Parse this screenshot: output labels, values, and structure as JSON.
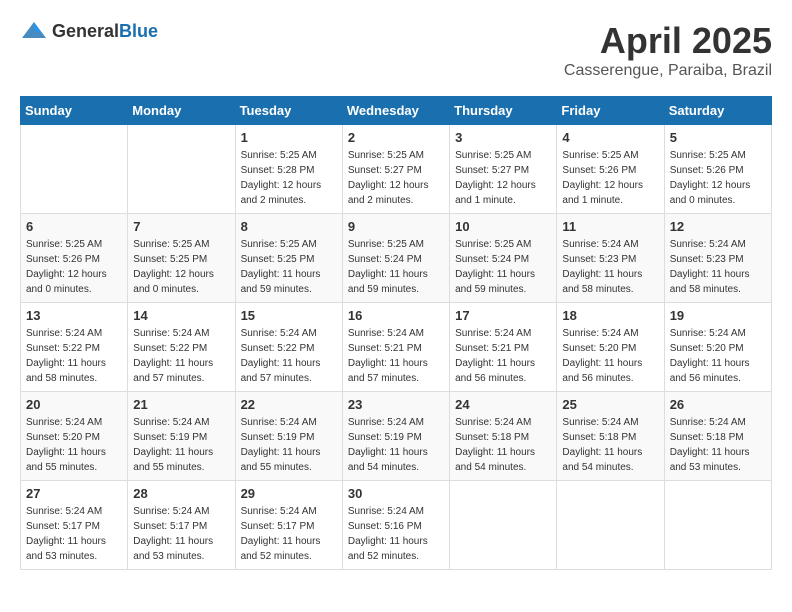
{
  "logo": {
    "general": "General",
    "blue": "Blue"
  },
  "header": {
    "month": "April 2025",
    "location": "Casserengue, Paraiba, Brazil"
  },
  "weekdays": [
    "Sunday",
    "Monday",
    "Tuesday",
    "Wednesday",
    "Thursday",
    "Friday",
    "Saturday"
  ],
  "weeks": [
    [
      {
        "day": "",
        "info": ""
      },
      {
        "day": "",
        "info": ""
      },
      {
        "day": "1",
        "info": "Sunrise: 5:25 AM\nSunset: 5:28 PM\nDaylight: 12 hours\nand 2 minutes."
      },
      {
        "day": "2",
        "info": "Sunrise: 5:25 AM\nSunset: 5:27 PM\nDaylight: 12 hours\nand 2 minutes."
      },
      {
        "day": "3",
        "info": "Sunrise: 5:25 AM\nSunset: 5:27 PM\nDaylight: 12 hours\nand 1 minute."
      },
      {
        "day": "4",
        "info": "Sunrise: 5:25 AM\nSunset: 5:26 PM\nDaylight: 12 hours\nand 1 minute."
      },
      {
        "day": "5",
        "info": "Sunrise: 5:25 AM\nSunset: 5:26 PM\nDaylight: 12 hours\nand 0 minutes."
      }
    ],
    [
      {
        "day": "6",
        "info": "Sunrise: 5:25 AM\nSunset: 5:26 PM\nDaylight: 12 hours\nand 0 minutes."
      },
      {
        "day": "7",
        "info": "Sunrise: 5:25 AM\nSunset: 5:25 PM\nDaylight: 12 hours\nand 0 minutes."
      },
      {
        "day": "8",
        "info": "Sunrise: 5:25 AM\nSunset: 5:25 PM\nDaylight: 11 hours\nand 59 minutes."
      },
      {
        "day": "9",
        "info": "Sunrise: 5:25 AM\nSunset: 5:24 PM\nDaylight: 11 hours\nand 59 minutes."
      },
      {
        "day": "10",
        "info": "Sunrise: 5:25 AM\nSunset: 5:24 PM\nDaylight: 11 hours\nand 59 minutes."
      },
      {
        "day": "11",
        "info": "Sunrise: 5:24 AM\nSunset: 5:23 PM\nDaylight: 11 hours\nand 58 minutes."
      },
      {
        "day": "12",
        "info": "Sunrise: 5:24 AM\nSunset: 5:23 PM\nDaylight: 11 hours\nand 58 minutes."
      }
    ],
    [
      {
        "day": "13",
        "info": "Sunrise: 5:24 AM\nSunset: 5:22 PM\nDaylight: 11 hours\nand 58 minutes."
      },
      {
        "day": "14",
        "info": "Sunrise: 5:24 AM\nSunset: 5:22 PM\nDaylight: 11 hours\nand 57 minutes."
      },
      {
        "day": "15",
        "info": "Sunrise: 5:24 AM\nSunset: 5:22 PM\nDaylight: 11 hours\nand 57 minutes."
      },
      {
        "day": "16",
        "info": "Sunrise: 5:24 AM\nSunset: 5:21 PM\nDaylight: 11 hours\nand 57 minutes."
      },
      {
        "day": "17",
        "info": "Sunrise: 5:24 AM\nSunset: 5:21 PM\nDaylight: 11 hours\nand 56 minutes."
      },
      {
        "day": "18",
        "info": "Sunrise: 5:24 AM\nSunset: 5:20 PM\nDaylight: 11 hours\nand 56 minutes."
      },
      {
        "day": "19",
        "info": "Sunrise: 5:24 AM\nSunset: 5:20 PM\nDaylight: 11 hours\nand 56 minutes."
      }
    ],
    [
      {
        "day": "20",
        "info": "Sunrise: 5:24 AM\nSunset: 5:20 PM\nDaylight: 11 hours\nand 55 minutes."
      },
      {
        "day": "21",
        "info": "Sunrise: 5:24 AM\nSunset: 5:19 PM\nDaylight: 11 hours\nand 55 minutes."
      },
      {
        "day": "22",
        "info": "Sunrise: 5:24 AM\nSunset: 5:19 PM\nDaylight: 11 hours\nand 55 minutes."
      },
      {
        "day": "23",
        "info": "Sunrise: 5:24 AM\nSunset: 5:19 PM\nDaylight: 11 hours\nand 54 minutes."
      },
      {
        "day": "24",
        "info": "Sunrise: 5:24 AM\nSunset: 5:18 PM\nDaylight: 11 hours\nand 54 minutes."
      },
      {
        "day": "25",
        "info": "Sunrise: 5:24 AM\nSunset: 5:18 PM\nDaylight: 11 hours\nand 54 minutes."
      },
      {
        "day": "26",
        "info": "Sunrise: 5:24 AM\nSunset: 5:18 PM\nDaylight: 11 hours\nand 53 minutes."
      }
    ],
    [
      {
        "day": "27",
        "info": "Sunrise: 5:24 AM\nSunset: 5:17 PM\nDaylight: 11 hours\nand 53 minutes."
      },
      {
        "day": "28",
        "info": "Sunrise: 5:24 AM\nSunset: 5:17 PM\nDaylight: 11 hours\nand 53 minutes."
      },
      {
        "day": "29",
        "info": "Sunrise: 5:24 AM\nSunset: 5:17 PM\nDaylight: 11 hours\nand 52 minutes."
      },
      {
        "day": "30",
        "info": "Sunrise: 5:24 AM\nSunset: 5:16 PM\nDaylight: 11 hours\nand 52 minutes."
      },
      {
        "day": "",
        "info": ""
      },
      {
        "day": "",
        "info": ""
      },
      {
        "day": "",
        "info": ""
      }
    ]
  ]
}
